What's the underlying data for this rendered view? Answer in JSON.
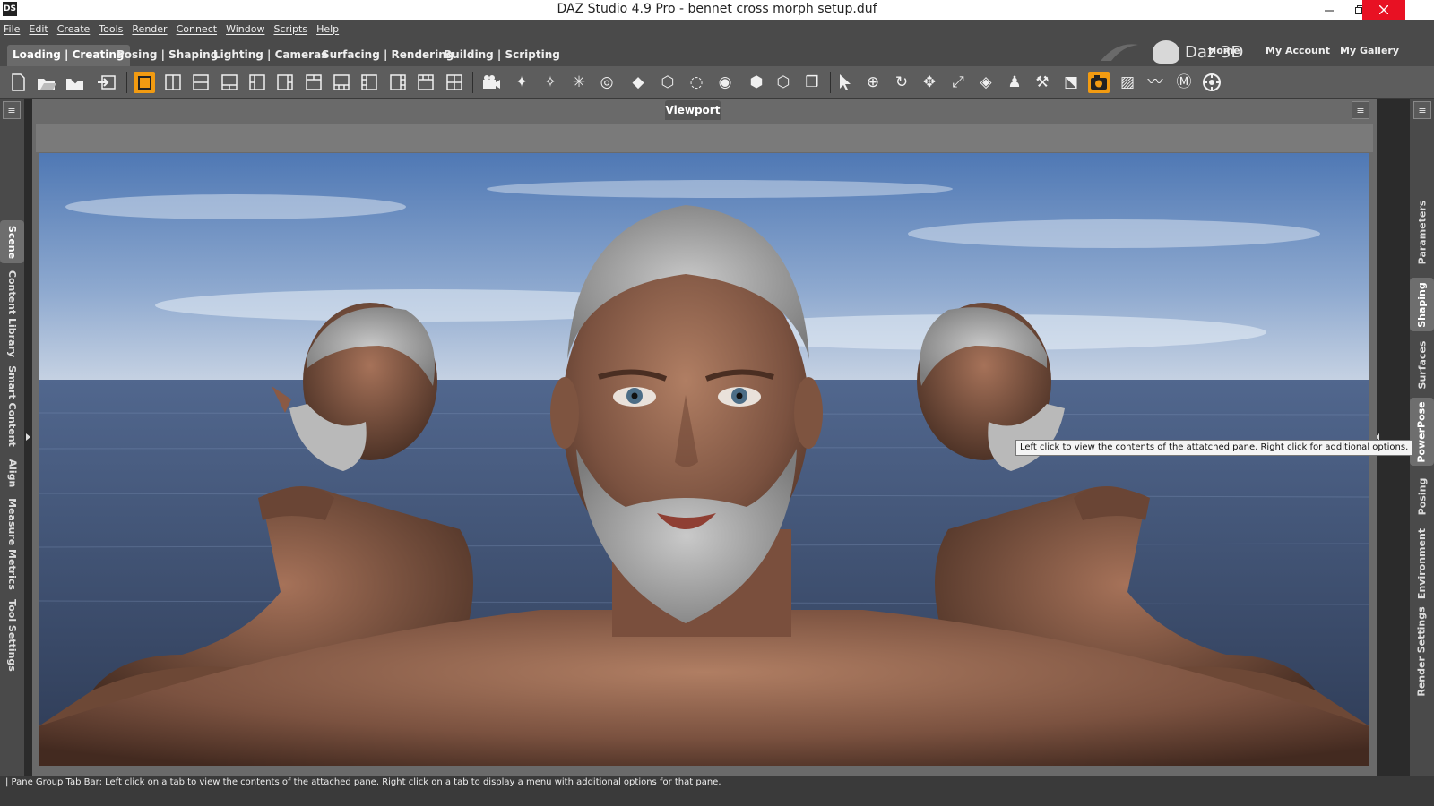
{
  "window": {
    "title": "DAZ Studio 4.9 Pro - bennet cross morph setup.duf",
    "app_icon": "DS",
    "controls": [
      "minimize-icon",
      "restore-icon",
      "close-icon"
    ]
  },
  "menu": [
    "File",
    "Edit",
    "Create",
    "Tools",
    "Render",
    "Connect",
    "Window",
    "Scripts",
    "Help"
  ],
  "layout_tabs": [
    {
      "label": "Loading | Creating",
      "active": true
    },
    {
      "label": "Posing | Shaping",
      "active": false
    },
    {
      "label": "Lighting | Cameras",
      "active": false
    },
    {
      "label": "Surfacing | Rendering",
      "active": false
    },
    {
      "label": "Building | Scripting",
      "active": false
    }
  ],
  "brand": {
    "name": "Daz 3D"
  },
  "top_links": [
    "Home",
    "My Account",
    "My Gallery"
  ],
  "toolbar": {
    "file_tools": [
      "new-file-icon",
      "open-file-icon",
      "merge-file-icon",
      "import-icon"
    ],
    "view_layouts": [
      "single-view-icon",
      "split-vertical-icon",
      "split-horizontal-icon",
      "split-bottom-icon",
      "split-left-icon",
      "split-right-icon",
      "split-top-icon",
      "three-bottom-icon",
      "three-left-icon",
      "three-right-icon",
      "three-top-icon",
      "quad-view-icon"
    ],
    "create_tools": [
      "create-camera-icon",
      "create-spotlight-icon",
      "create-point-light-icon",
      "create-distant-light-icon",
      "create-area-light-icon",
      "create-primitive-icon",
      "create-null-icon",
      "create-group-icon",
      "create-instance-icon",
      "create-proxy-icon",
      "create-node-icon",
      "create-figure-icon"
    ],
    "manip_tools": [
      "node-selection-icon",
      "universal-tool-icon",
      "rotate-tool-icon",
      "translate-tool-icon",
      "scale-tool-icon",
      "surface-selection-icon",
      "active-pose-icon",
      "joint-editor-icon",
      "geometry-editor-icon",
      "spot-render-icon",
      "geometry-sculptor-icon",
      "figure-setup-icon",
      "morph-loader-icon",
      "transform-gizmo-icon"
    ],
    "active_tool": "spot-render-icon"
  },
  "left_tabs": [
    {
      "label": "Scene",
      "active": true
    },
    {
      "label": "Content Library",
      "active": false
    },
    {
      "label": "Smart Content",
      "active": false
    },
    {
      "label": "Align",
      "active": false
    },
    {
      "label": "Measure Metrics",
      "active": false
    },
    {
      "label": "Tool Settings",
      "active": false
    }
  ],
  "right_tabs": [
    {
      "label": "Parameters",
      "active": false
    },
    {
      "label": "Shaping",
      "active": true
    },
    {
      "label": "Surfaces",
      "active": false
    },
    {
      "label": "PowerPose",
      "active": false
    },
    {
      "label": "Posing",
      "active": false
    },
    {
      "label": "Environment",
      "active": false
    },
    {
      "label": "Render Settings",
      "active": false
    }
  ],
  "viewport": {
    "tab_label": "Viewport"
  },
  "tooltip": "Left click to view the contents of the attatched pane. Right click for additional options.",
  "status": "| Pane Group Tab Bar: Left click on a tab to view the contents of the attached pane. Right click on a tab to display a menu with additional options for that pane.",
  "colors": {
    "accent": "#f29b11",
    "chrome": "#4a4a4a",
    "toolbar": "#5d5d5d",
    "close": "#e81123"
  }
}
